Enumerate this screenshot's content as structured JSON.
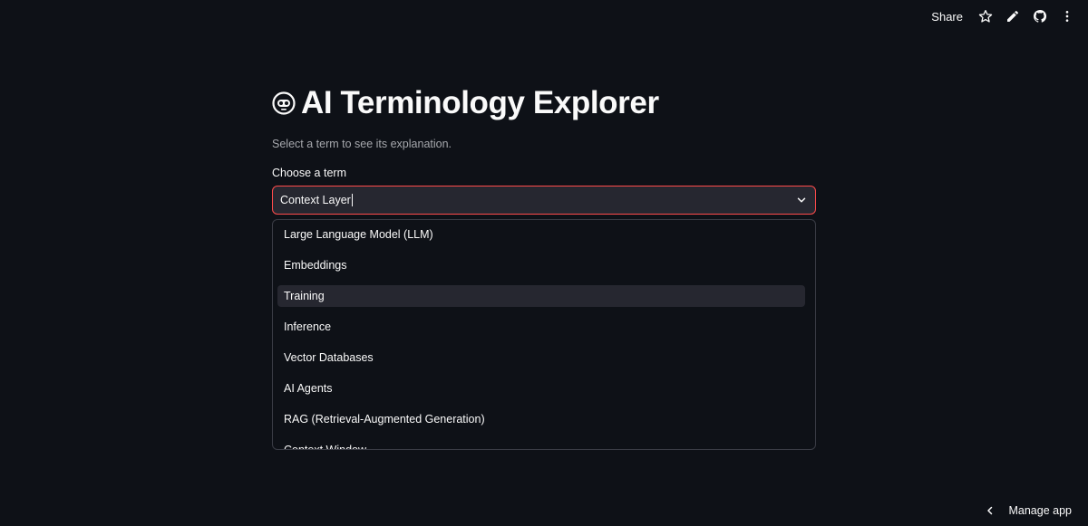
{
  "toolbar": {
    "share_label": "Share",
    "icons": [
      "star-icon",
      "pencil-icon",
      "github-icon",
      "more-vertical-icon"
    ]
  },
  "header": {
    "icon": "robot-face-icon",
    "title": "AI Terminology Explorer",
    "subtitle": "Select a term to see its explanation."
  },
  "select": {
    "label": "Choose a term",
    "value": "Context Layer",
    "options": [
      "Large Language Model (LLM)",
      "Embeddings",
      "Training",
      "Inference",
      "Vector Databases",
      "AI Agents",
      "RAG (Retrieval-Augmented Generation)",
      "Context Window"
    ],
    "highlighted": "Training"
  },
  "footer": {
    "manage_label": "Manage app"
  },
  "colors": {
    "background": "#0e1117",
    "focus_border": "#ff4b4b",
    "input_bg": "#262730"
  }
}
